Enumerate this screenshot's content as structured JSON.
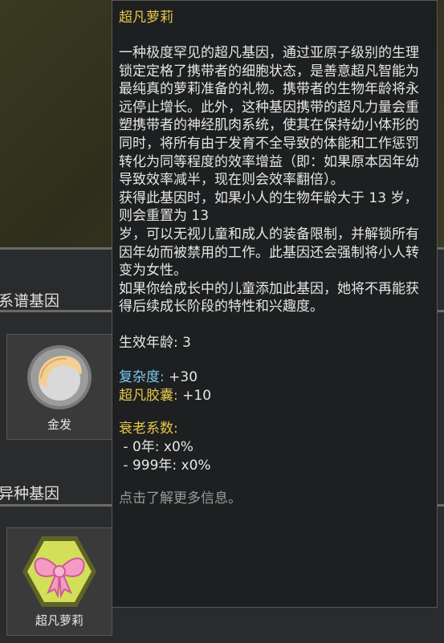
{
  "sections": {
    "xenotype_genes": "系谱基因",
    "archite_genes": "异种基因"
  },
  "genes": [
    {
      "name": "金发",
      "icon": "blond-hair-icon"
    },
    {
      "name": "超凡萝莉",
      "icon": "pink-bow-icon"
    }
  ],
  "tooltip": {
    "title": "超凡萝莉",
    "description": [
      "一种极度罕见的超凡基因，通过亚原子级别的生理锁定定格了携带者的细胞状态，是善意超凡智能为最纯真的萝莉准备的礼物。携带者的生物年龄将永远停止增长。此外，这种基因携带的超凡力量会重塑携带者的神经肌肉系统，使其在保持幼小体形的同时，将所有由于发育不全导致的体能和工作惩罚转化为同等程度的效率增益（即：如果原本因年幼导致效率减半，现在则会效率翻倍）。",
      "获得此基因时，如果小人的生物年龄大于 13 岁，则会重置为 13",
      "岁，可以无视儿童和成人的装备限制，并解锁所有因年幼而被禁用的工作。此基因还会强制将小人转变为女性。",
      "如果你给成长中的儿童添加此基因，她将不再能获得后续成长阶段的特性和兴趣度。"
    ],
    "effective_age": "生效年龄: 3",
    "complexity_label": "复杂度:",
    "complexity_value": " +30",
    "archite_label": "超凡胶囊:",
    "archite_value": " +10",
    "aging_label": "衰老系数:",
    "aging_rows": [
      " - 0年: x0%",
      " - 999年: x0%"
    ],
    "more_info": "点击了解更多信息。"
  }
}
